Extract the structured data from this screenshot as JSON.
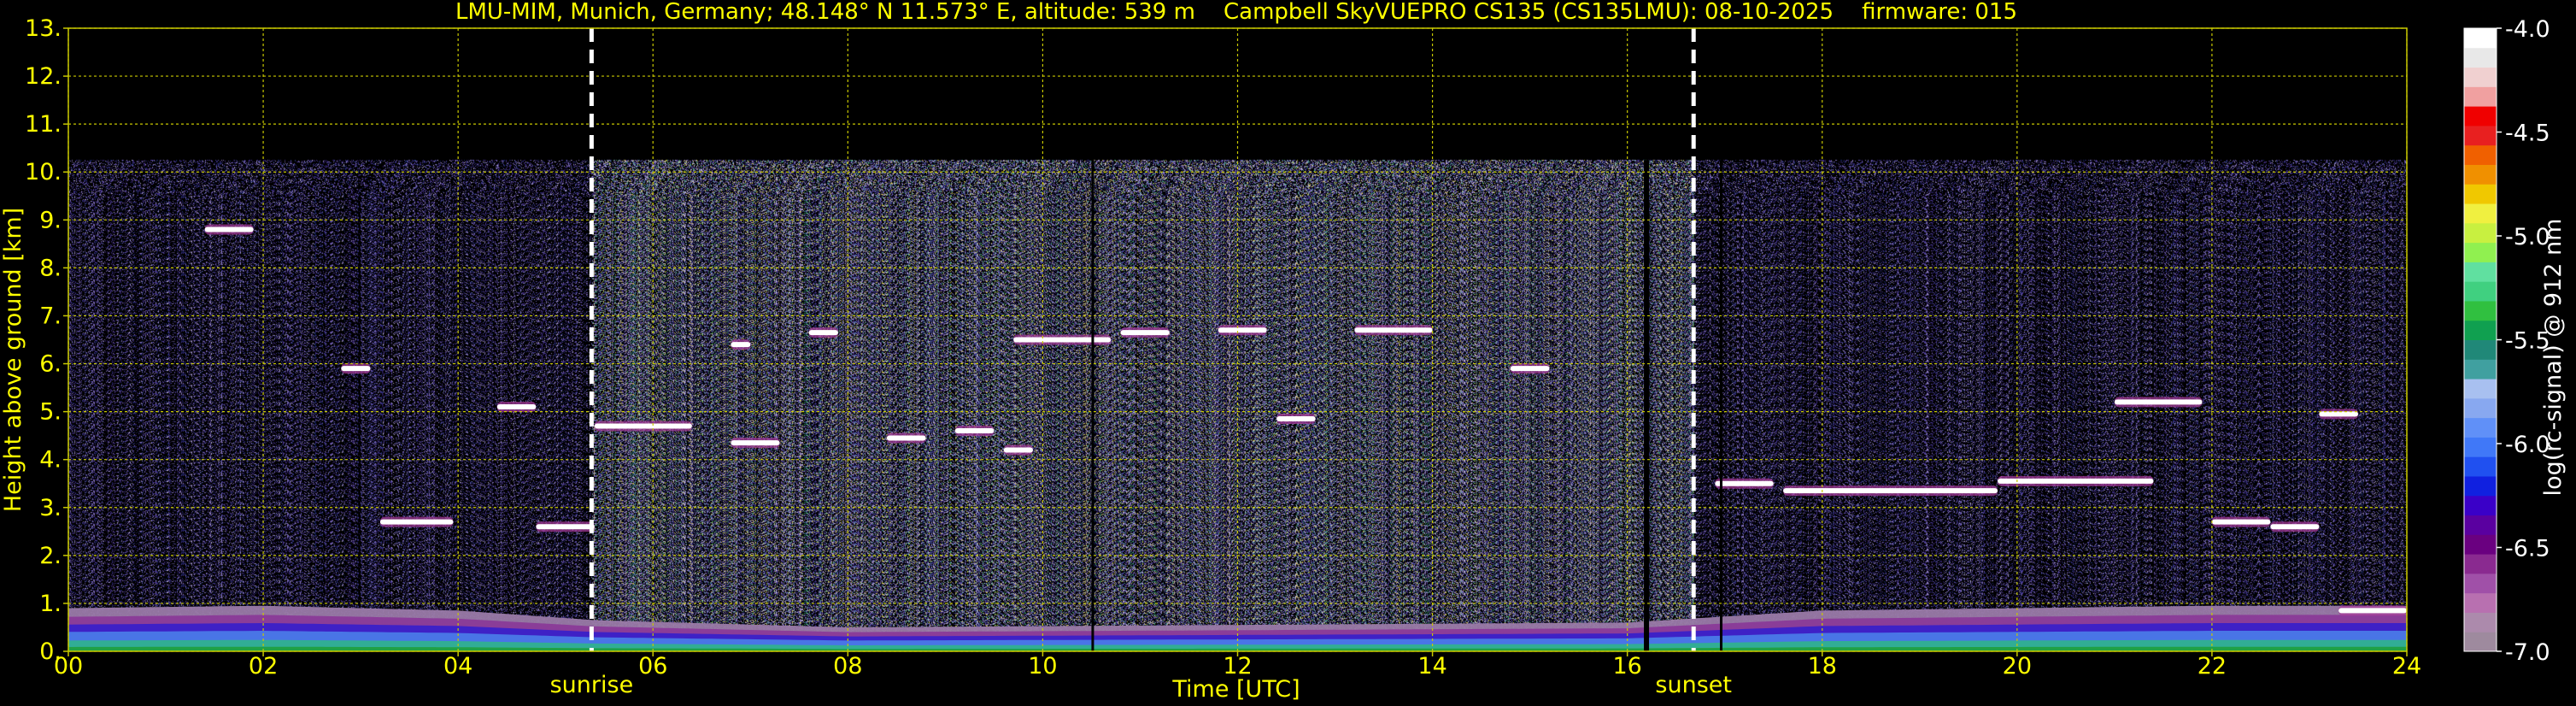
{
  "chart_data": {
    "type": "heatmap",
    "title": "LMU-MIM, Munich, Germany; 48.148° N 11.573° E, altitude: 539 m    Campbell SkyVUEPRO CS135 (CS135LMU): 08-10-2025    firmware: 015",
    "xlabel": "Time [UTC]",
    "ylabel": "Height above ground [km]",
    "xlim": [
      0,
      24
    ],
    "ylim": [
      0,
      13
    ],
    "x_ticks": [
      "00",
      "02",
      "04",
      "06",
      "08",
      "10",
      "12",
      "14",
      "16",
      "18",
      "20",
      "22",
      "24"
    ],
    "y_ticks": [
      "0.",
      "1.",
      "2.",
      "3.",
      "4.",
      "5.",
      "6.",
      "7.",
      "8.",
      "9.",
      "10.",
      "11.",
      "12.",
      "13."
    ],
    "grid": true,
    "grid_color": "#c8c800",
    "markers": [
      {
        "label": "sunrise",
        "x": 5.37
      },
      {
        "label": "sunset",
        "x": 16.68
      }
    ],
    "colorbar": {
      "label": "log(rc-signal) @ 912 nm",
      "range": [
        -7.0,
        -4.0
      ],
      "ticks": [
        "-4.0",
        "-4.5",
        "-5.0",
        "-5.5",
        "-6.0",
        "-6.5",
        "-7.0"
      ],
      "colors": [
        "#9e8a9e",
        "#ac8aac",
        "#b870b0",
        "#a050a8",
        "#8a2a90",
        "#6a0080",
        "#5a00a0",
        "#3a00c8",
        "#1020e0",
        "#2050f0",
        "#4078f8",
        "#6090f8",
        "#88a8f0",
        "#a8c0f0",
        "#40a0a0",
        "#208878",
        "#10a050",
        "#30c040",
        "#40d080",
        "#60e0a0",
        "#90f050",
        "#c8f040",
        "#f0f040",
        "#f0c800",
        "#f09000",
        "#f06000",
        "#e82020",
        "#f00000",
        "#f0a0a0",
        "#f0d0d0",
        "#e8e8e8",
        "#ffffff"
      ]
    },
    "boundary_layer": [
      {
        "t": 0,
        "h": 0.9
      },
      {
        "t": 2,
        "h": 0.95
      },
      {
        "t": 4,
        "h": 0.85
      },
      {
        "t": 5.4,
        "h": 0.65
      },
      {
        "t": 8,
        "h": 0.5
      },
      {
        "t": 12,
        "h": 0.55
      },
      {
        "t": 16,
        "h": 0.6
      },
      {
        "t": 18,
        "h": 0.85
      },
      {
        "t": 22,
        "h": 0.95
      },
      {
        "t": 24,
        "h": 0.95
      }
    ],
    "signal_top_km": 10.25,
    "cloud_layers": [
      {
        "t0": 1.4,
        "t1": 1.9,
        "h": 8.8
      },
      {
        "t0": 2.8,
        "t1": 3.1,
        "h": 5.9
      },
      {
        "t0": 3.2,
        "t1": 3.95,
        "h": 2.7
      },
      {
        "t0": 4.4,
        "t1": 4.8,
        "h": 5.1
      },
      {
        "t0": 4.8,
        "t1": 5.4,
        "h": 2.6
      },
      {
        "t0": 5.4,
        "t1": 6.4,
        "h": 4.7
      },
      {
        "t0": 6.8,
        "t1": 7.3,
        "h": 4.35
      },
      {
        "t0": 6.8,
        "t1": 7.0,
        "h": 6.4
      },
      {
        "t0": 7.6,
        "t1": 7.9,
        "h": 6.65
      },
      {
        "t0": 8.4,
        "t1": 8.8,
        "h": 4.45
      },
      {
        "t0": 9.1,
        "t1": 9.5,
        "h": 4.6
      },
      {
        "t0": 9.6,
        "t1": 9.9,
        "h": 4.2
      },
      {
        "t0": 9.7,
        "t1": 10.7,
        "h": 6.5
      },
      {
        "t0": 10.8,
        "t1": 11.3,
        "h": 6.65
      },
      {
        "t0": 11.8,
        "t1": 12.3,
        "h": 6.7
      },
      {
        "t0": 12.4,
        "t1": 12.8,
        "h": 4.85
      },
      {
        "t0": 13.2,
        "t1": 14.0,
        "h": 6.7
      },
      {
        "t0": 14.8,
        "t1": 15.2,
        "h": 5.9
      },
      {
        "t0": 16.9,
        "t1": 17.5,
        "h": 3.5
      },
      {
        "t0": 17.6,
        "t1": 19.8,
        "h": 3.35
      },
      {
        "t0": 19.8,
        "t1": 21.4,
        "h": 3.55
      },
      {
        "t0": 21.0,
        "t1": 21.9,
        "h": 5.2
      },
      {
        "t0": 22.0,
        "t1": 22.6,
        "h": 2.7
      },
      {
        "t0": 22.6,
        "t1": 23.1,
        "h": 2.6
      },
      {
        "t0": 23.1,
        "t1": 23.5,
        "h": 4.95
      },
      {
        "t0": 23.3,
        "t1": 24.0,
        "h": 0.85
      }
    ]
  }
}
